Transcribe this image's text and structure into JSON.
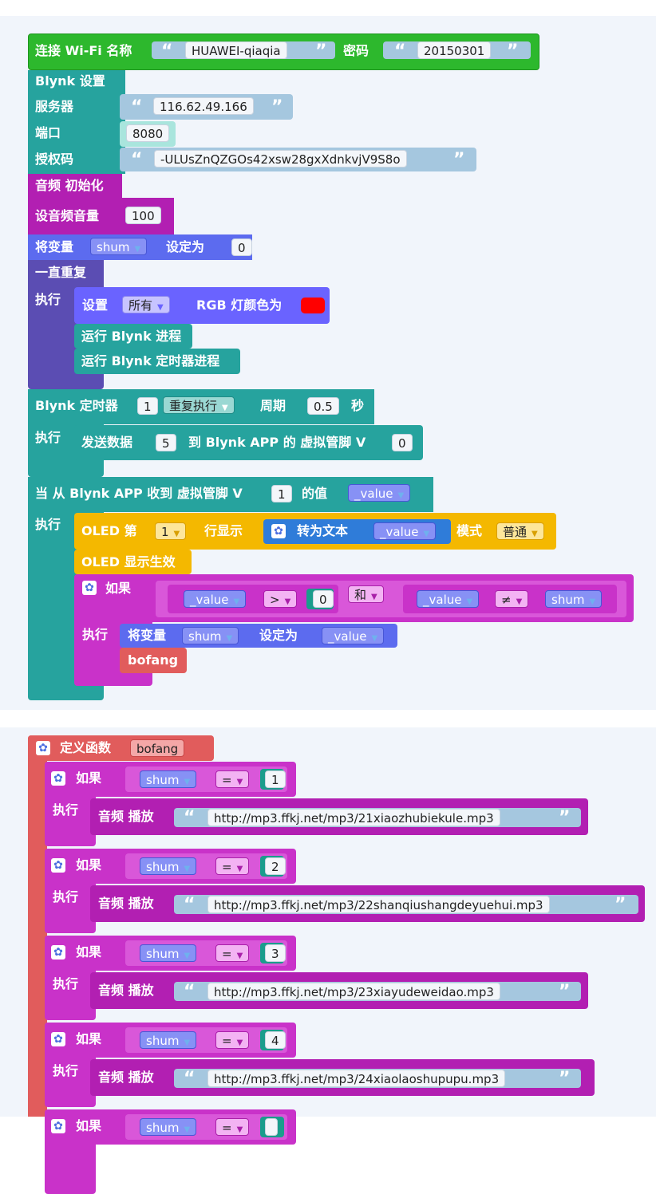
{
  "wifi": {
    "label": "连接 Wi-Fi 名称",
    "ssid": "HUAWEI-qiaqia",
    "password_label": "密码",
    "password": "20150301"
  },
  "blynk": {
    "title": "Blynk 设置",
    "server_label": "服务器",
    "server": "116.62.49.166",
    "port_label": "端口",
    "port": "8080",
    "auth_label": "授权码",
    "auth": "-ULUsZnQZGOs42xsw28gxXdnkvjV9S8o"
  },
  "audio": {
    "init": "音频 初始化",
    "set_volume": "设音频音量",
    "volume": "100"
  },
  "setvar1": {
    "prefix": "将变量",
    "var": "shum",
    "set_to": "设定为",
    "value": "0"
  },
  "loop": {
    "title": "一直重复",
    "do": "执行",
    "rgb_prefix": "设置",
    "rgb_target": "所有",
    "rgb_text": "RGB 灯颜色为",
    "rgb_color": "#ff0000",
    "run": "运行 Blynk 进程",
    "run_timer": "运行 Blynk 定时器进程"
  },
  "timer": {
    "title": "Blynk 定时器",
    "num": "1",
    "mode": "重复执行",
    "period_label": "周期",
    "period": "0.5",
    "sec": "秒",
    "do": "执行",
    "send": "发送数据",
    "send_val": "5",
    "to_app": "到 Blynk APP 的 虚拟管脚 V",
    "pin": "0"
  },
  "receive": {
    "title": "当 从 Blynk APP 收到 虚拟管脚 V",
    "pin": "1",
    "value_of": "的值",
    "param": "_value",
    "do": "执行",
    "oled_prefix": "OLED 第",
    "oled_row": "1",
    "oled_row_label": "行显示",
    "to_text": "转为文本",
    "mode_label": "模式",
    "mode": "普通",
    "oled_show": "OLED 显示生效",
    "if": "如果",
    "gt": ">",
    "zero": "0",
    "and": "和",
    "neq": "≠",
    "shum": "shum",
    "then": "执行",
    "setvar_prefix": "将变量",
    "set_to": "设定为",
    "call": "bofang"
  },
  "func": {
    "define": "定义函数",
    "name": "bofang",
    "if": "如果",
    "then": "执行",
    "var": "shum",
    "eq": "=",
    "play": "音频 播放",
    "cases": [
      {
        "num": "1",
        "url": "http://mp3.ffkj.net/mp3/21xiaozhubiekule.mp3"
      },
      {
        "num": "2",
        "url": "http://mp3.ffkj.net/mp3/22shanqiushangdeyuehui.mp3"
      },
      {
        "num": "3",
        "url": "http://mp3.ffkj.net/mp3/23xiayudeweidao.mp3"
      },
      {
        "num": "4",
        "url": "http://mp3.ffkj.net/mp3/24xiaolaoshupupu.mp3"
      }
    ]
  },
  "colors": {
    "wifi": "#2db82d",
    "blynk": "#26a39e",
    "audio": "#b21fb2",
    "var": "#5c6bef",
    "loop": "#5b4db3",
    "rgb": "#6a63ff",
    "oled": "#f4b800",
    "logic": "#c932c9",
    "func": "#e15c5c",
    "field_blue": "#a5c7df"
  }
}
